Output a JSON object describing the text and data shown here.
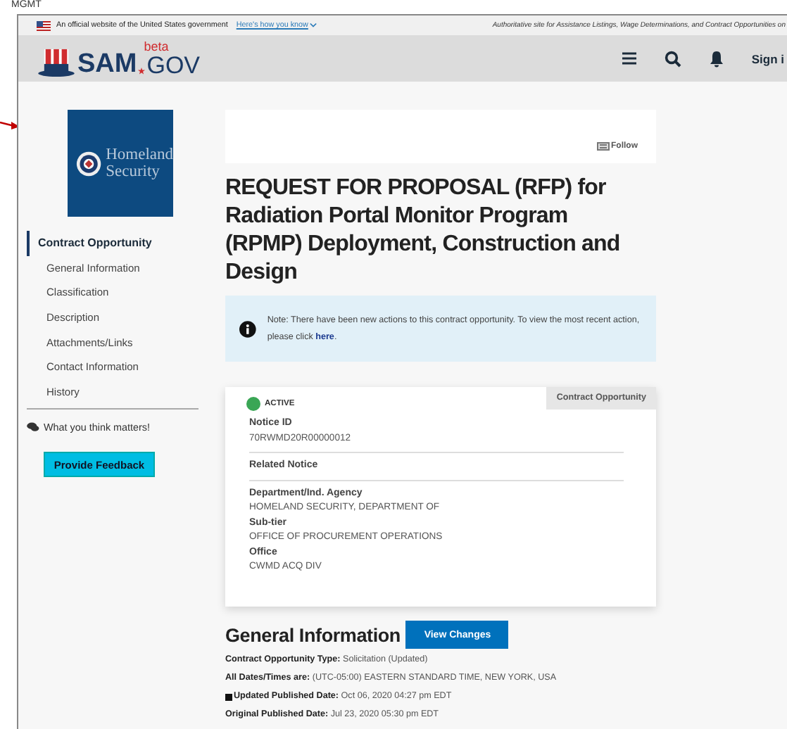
{
  "background": {
    "cell_text": "MGMT"
  },
  "banner": {
    "text": "An official website of the United States government",
    "link": "Here's how you know",
    "tagline": "Authoritative site for Assistance Listings, Wage Determinations, and Contract Opportunities on"
  },
  "header": {
    "logo_main": "SAM",
    "logo_super": "beta",
    "logo_suffix": "GOV",
    "sign_in": "Sign i"
  },
  "sidebar": {
    "agency_logo": [
      "Homeland",
      "Security"
    ],
    "nav": [
      {
        "label": "Contract Opportunity",
        "selected": true
      },
      {
        "label": "General Information",
        "selected": false
      },
      {
        "label": "Classification",
        "selected": false
      },
      {
        "label": "Description",
        "selected": false
      },
      {
        "label": "Attachments/Links",
        "selected": false
      },
      {
        "label": "Contact Information",
        "selected": false
      },
      {
        "label": "History",
        "selected": false
      }
    ],
    "feedback_prompt": "What you think matters!",
    "feedback_button": "Provide Feedback"
  },
  "main": {
    "follow": "Follow",
    "title": "REQUEST FOR PROPOSAL (RFP) for Radiation Portal Monitor Program (RPMP) Deployment, Construction and Design",
    "note": {
      "text": "Note: There have been new actions to this contract opportunity. To view the most recent action, please click",
      "link": "here",
      "after": "."
    },
    "card": {
      "status": {
        "label": "ACTIVE",
        "active": true
      },
      "tab": "Contract Opportunity",
      "sections": [
        [
          {
            "label": "Notice ID",
            "value": "70RWMD20R00000012"
          }
        ],
        [
          {
            "label": "Related Notice"
          }
        ],
        [
          {
            "label": "Department/Ind. Agency",
            "value": "HOMELAND SECURITY, DEPARTMENT OF"
          },
          {
            "label": "Sub-tier",
            "value": "OFFICE OF PROCUREMENT OPERATIONS"
          },
          {
            "label": "Office",
            "value": "CWMD ACQ DIV"
          }
        ]
      ]
    },
    "general": {
      "heading": "General Information",
      "button": "View Changes",
      "lines": [
        {
          "label": "Contract Opportunity Type:",
          "value": "Solicitation (Updated)",
          "kind": "plain"
        },
        {
          "label": "All Dates/Times are:",
          "value": "(UTC-05:00) EASTERN STANDARD TIME, NEW YORK, USA",
          "kind": "plain"
        },
        {
          "label": "Updated Published Date:",
          "value": "Oct 06, 2020 04:27 pm EDT",
          "kind": "flagged"
        },
        {
          "label": "Original Published Date:",
          "value": "Jul 23, 2020 05:30 pm EDT",
          "kind": "plain"
        }
      ]
    }
  }
}
